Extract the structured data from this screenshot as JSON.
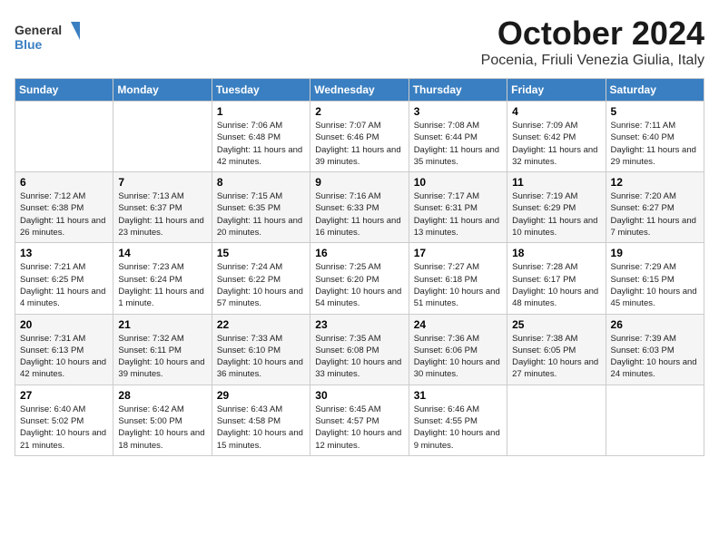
{
  "header": {
    "logo_general": "General",
    "logo_blue": "Blue",
    "month_title": "October 2024",
    "location": "Pocenia, Friuli Venezia Giulia, Italy"
  },
  "days_of_week": [
    "Sunday",
    "Monday",
    "Tuesday",
    "Wednesday",
    "Thursday",
    "Friday",
    "Saturday"
  ],
  "weeks": [
    [
      {
        "day": "",
        "info": ""
      },
      {
        "day": "",
        "info": ""
      },
      {
        "day": "1",
        "info": "Sunrise: 7:06 AM\nSunset: 6:48 PM\nDaylight: 11 hours and 42 minutes."
      },
      {
        "day": "2",
        "info": "Sunrise: 7:07 AM\nSunset: 6:46 PM\nDaylight: 11 hours and 39 minutes."
      },
      {
        "day": "3",
        "info": "Sunrise: 7:08 AM\nSunset: 6:44 PM\nDaylight: 11 hours and 35 minutes."
      },
      {
        "day": "4",
        "info": "Sunrise: 7:09 AM\nSunset: 6:42 PM\nDaylight: 11 hours and 32 minutes."
      },
      {
        "day": "5",
        "info": "Sunrise: 7:11 AM\nSunset: 6:40 PM\nDaylight: 11 hours and 29 minutes."
      }
    ],
    [
      {
        "day": "6",
        "info": "Sunrise: 7:12 AM\nSunset: 6:38 PM\nDaylight: 11 hours and 26 minutes."
      },
      {
        "day": "7",
        "info": "Sunrise: 7:13 AM\nSunset: 6:37 PM\nDaylight: 11 hours and 23 minutes."
      },
      {
        "day": "8",
        "info": "Sunrise: 7:15 AM\nSunset: 6:35 PM\nDaylight: 11 hours and 20 minutes."
      },
      {
        "day": "9",
        "info": "Sunrise: 7:16 AM\nSunset: 6:33 PM\nDaylight: 11 hours and 16 minutes."
      },
      {
        "day": "10",
        "info": "Sunrise: 7:17 AM\nSunset: 6:31 PM\nDaylight: 11 hours and 13 minutes."
      },
      {
        "day": "11",
        "info": "Sunrise: 7:19 AM\nSunset: 6:29 PM\nDaylight: 11 hours and 10 minutes."
      },
      {
        "day": "12",
        "info": "Sunrise: 7:20 AM\nSunset: 6:27 PM\nDaylight: 11 hours and 7 minutes."
      }
    ],
    [
      {
        "day": "13",
        "info": "Sunrise: 7:21 AM\nSunset: 6:25 PM\nDaylight: 11 hours and 4 minutes."
      },
      {
        "day": "14",
        "info": "Sunrise: 7:23 AM\nSunset: 6:24 PM\nDaylight: 11 hours and 1 minute."
      },
      {
        "day": "15",
        "info": "Sunrise: 7:24 AM\nSunset: 6:22 PM\nDaylight: 10 hours and 57 minutes."
      },
      {
        "day": "16",
        "info": "Sunrise: 7:25 AM\nSunset: 6:20 PM\nDaylight: 10 hours and 54 minutes."
      },
      {
        "day": "17",
        "info": "Sunrise: 7:27 AM\nSunset: 6:18 PM\nDaylight: 10 hours and 51 minutes."
      },
      {
        "day": "18",
        "info": "Sunrise: 7:28 AM\nSunset: 6:17 PM\nDaylight: 10 hours and 48 minutes."
      },
      {
        "day": "19",
        "info": "Sunrise: 7:29 AM\nSunset: 6:15 PM\nDaylight: 10 hours and 45 minutes."
      }
    ],
    [
      {
        "day": "20",
        "info": "Sunrise: 7:31 AM\nSunset: 6:13 PM\nDaylight: 10 hours and 42 minutes."
      },
      {
        "day": "21",
        "info": "Sunrise: 7:32 AM\nSunset: 6:11 PM\nDaylight: 10 hours and 39 minutes."
      },
      {
        "day": "22",
        "info": "Sunrise: 7:33 AM\nSunset: 6:10 PM\nDaylight: 10 hours and 36 minutes."
      },
      {
        "day": "23",
        "info": "Sunrise: 7:35 AM\nSunset: 6:08 PM\nDaylight: 10 hours and 33 minutes."
      },
      {
        "day": "24",
        "info": "Sunrise: 7:36 AM\nSunset: 6:06 PM\nDaylight: 10 hours and 30 minutes."
      },
      {
        "day": "25",
        "info": "Sunrise: 7:38 AM\nSunset: 6:05 PM\nDaylight: 10 hours and 27 minutes."
      },
      {
        "day": "26",
        "info": "Sunrise: 7:39 AM\nSunset: 6:03 PM\nDaylight: 10 hours and 24 minutes."
      }
    ],
    [
      {
        "day": "27",
        "info": "Sunrise: 6:40 AM\nSunset: 5:02 PM\nDaylight: 10 hours and 21 minutes."
      },
      {
        "day": "28",
        "info": "Sunrise: 6:42 AM\nSunset: 5:00 PM\nDaylight: 10 hours and 18 minutes."
      },
      {
        "day": "29",
        "info": "Sunrise: 6:43 AM\nSunset: 4:58 PM\nDaylight: 10 hours and 15 minutes."
      },
      {
        "day": "30",
        "info": "Sunrise: 6:45 AM\nSunset: 4:57 PM\nDaylight: 10 hours and 12 minutes."
      },
      {
        "day": "31",
        "info": "Sunrise: 6:46 AM\nSunset: 4:55 PM\nDaylight: 10 hours and 9 minutes."
      },
      {
        "day": "",
        "info": ""
      },
      {
        "day": "",
        "info": ""
      }
    ]
  ]
}
